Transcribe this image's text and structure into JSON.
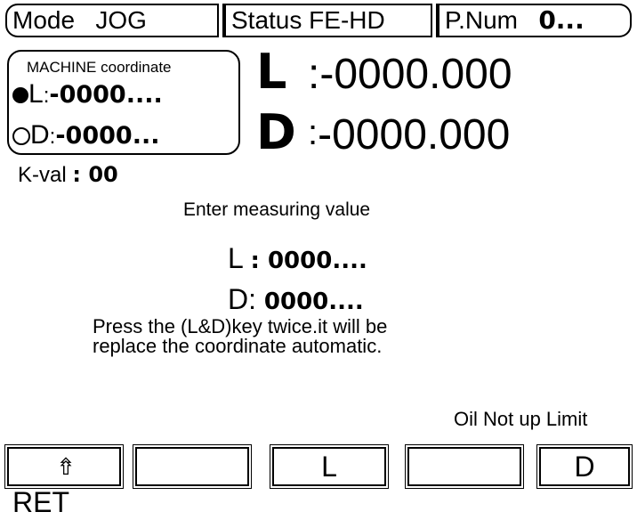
{
  "header": {
    "mode_label": "Mode",
    "mode_value": "JOG",
    "status_label": "Status",
    "status_value": "FE-HD",
    "pnum_label": "P.Num",
    "pnum_value": "0..."
  },
  "machine_panel": {
    "title": "MACHINE coordinate",
    "l_label": "L",
    "l_value": "-0000....",
    "d_label": "D",
    "d_value": "-0000..."
  },
  "main": {
    "l_label": "L",
    "l_value": ":-0000.000",
    "d_label": "D",
    "d_value": "-0000.000",
    "kval_label": "K-val",
    "kval_value": ": 00",
    "prompt": "Enter measuring value",
    "entry_l_label": "L",
    "entry_l_value": ": 0000....",
    "entry_d_label": "D:",
    "entry_d_value": "0000....",
    "note_line1": "Press the (L&D)key twice.it will be",
    "note_line2": "replace the coordinate automatic.",
    "status_message": "Oil Not up Limit"
  },
  "softkeys": [
    {
      "label": "RET",
      "icon": "return-arrow-icon"
    },
    {
      "label": ""
    },
    {
      "label": "L"
    },
    {
      "label": ""
    },
    {
      "label": "D"
    }
  ]
}
